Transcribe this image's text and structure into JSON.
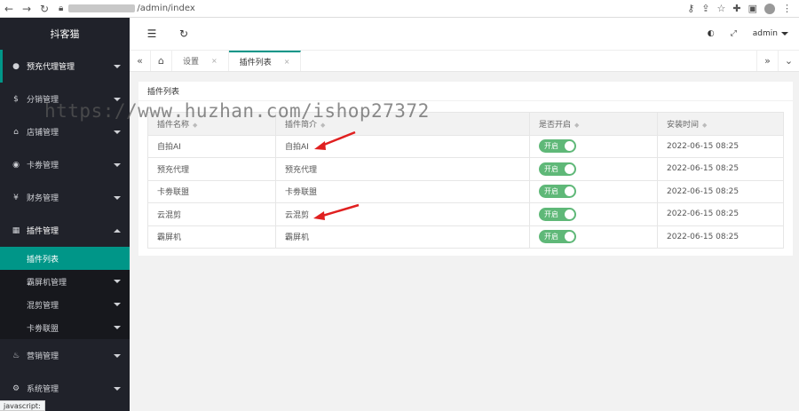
{
  "browser": {
    "url_path": "/admin/index",
    "status_tip": "javascript:"
  },
  "sidebar": {
    "logo": "抖客猫",
    "menu": [
      {
        "label": "预充代理管理",
        "icon": "user-icon"
      },
      {
        "label": "分销管理",
        "icon": "dollar-icon"
      },
      {
        "label": "店铺管理",
        "icon": "shop-icon"
      },
      {
        "label": "卡劵管理",
        "icon": "ticket-icon"
      },
      {
        "label": "财务管理",
        "icon": "yen-icon"
      },
      {
        "label": "插件管理",
        "icon": "plugin-icon"
      }
    ],
    "submenu": [
      {
        "label": "插件列表"
      },
      {
        "label": "霸屏机管理"
      },
      {
        "label": "混剪管理"
      },
      {
        "label": "卡劵联盟"
      }
    ],
    "menu_bottom": [
      {
        "label": "营销管理",
        "icon": "fire-icon"
      },
      {
        "label": "系统管理",
        "icon": "settings-icon"
      }
    ]
  },
  "header": {
    "user": "admin"
  },
  "tabs": [
    {
      "label": "设置"
    },
    {
      "label": "插件列表"
    }
  ],
  "card": {
    "title": "插件列表",
    "columns": [
      "插件名称",
      "插件简介",
      "是否开启",
      "安装时间"
    ],
    "rows": [
      {
        "name": "自拍AI",
        "intro": "自拍AI",
        "status": "开启",
        "time": "2022-06-15 08:25"
      },
      {
        "name": "预充代理",
        "intro": "预充代理",
        "status": "开启",
        "time": "2022-06-15 08:25"
      },
      {
        "name": "卡劵联盟",
        "intro": "卡劵联盟",
        "status": "开启",
        "time": "2022-06-15 08:25"
      },
      {
        "name": "云混剪",
        "intro": "云混剪",
        "status": "开启",
        "time": "2022-06-15 08:25"
      },
      {
        "name": "霸屏机",
        "intro": "霸屏机",
        "status": "开启",
        "time": "2022-06-15 08:25"
      }
    ]
  },
  "watermark": "https://www.huzhan.com/ishop27372",
  "colors": {
    "sidebar_bg": "#20222a",
    "accent": "#009688",
    "switch_on": "#5fb878",
    "arrow": "#e02020"
  }
}
